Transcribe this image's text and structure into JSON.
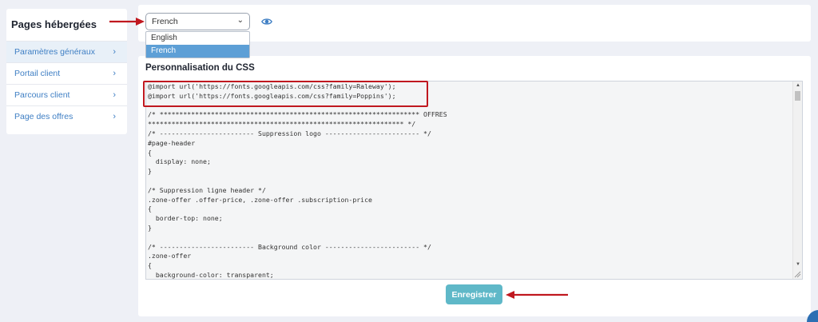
{
  "sidebar": {
    "title": "Pages hébergées",
    "items": [
      {
        "label": "Paramètres généraux"
      },
      {
        "label": "Portail client"
      },
      {
        "label": "Parcours client"
      },
      {
        "label": "Page des offres"
      }
    ]
  },
  "language": {
    "selected": "French",
    "options": [
      "English",
      "French"
    ]
  },
  "main": {
    "section_title": "Personnalisation du CSS",
    "css_code": "@import url('https://fonts.googleapis.com/css?family=Raleway');\n@import url('https://fonts.googleapis.com/css?family=Poppins');\n\n/* ****************************************************************** OFFRES\n***************************************************************** */\n/* ------------------------ Suppression logo ------------------------ */\n#page-header\n{\n  display: none;\n}\n\n/* Suppression ligne header */\n.zone-offer .offer-price, .zone-offer .subscription-price\n{\n  border-top: none;\n}\n\n/* ------------------------ Background color ------------------------ */\n.zone-offer\n{\n  background-color: transparent;",
    "save_label": "Enregistrer"
  },
  "icons": {
    "eye": "eye-icon",
    "chevron": "chevron-right-icon",
    "select": "chevron-down-icon"
  },
  "colors": {
    "link": "#3f7fc4",
    "accent_button": "#5fb8c8",
    "selected_option": "#5d9fd6",
    "annotation_red": "#c0181f"
  }
}
